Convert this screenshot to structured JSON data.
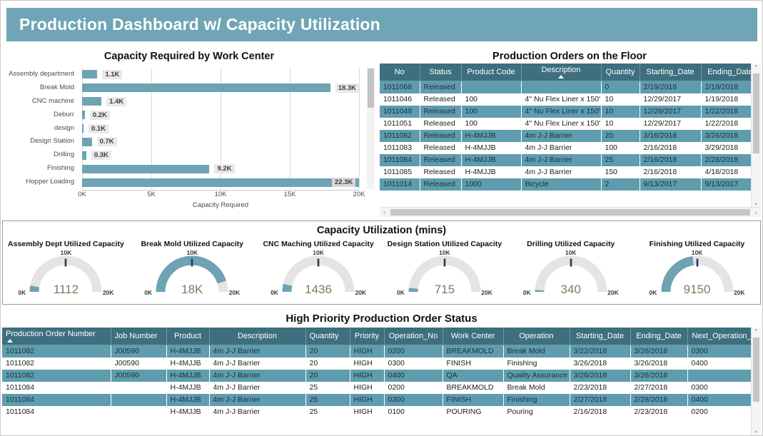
{
  "banner": {
    "title": "Production Dashboard w/ Capacity Utilization"
  },
  "chart_data": {
    "type": "bar",
    "orientation": "horizontal",
    "title": "Capacity Required by Work Center",
    "xlabel": "Capacity Required",
    "ylabel": "",
    "xlim": [
      0,
      20000
    ],
    "xticks": [
      "0K",
      "5K",
      "10K",
      "15K",
      "20K"
    ],
    "xtick_values": [
      0,
      5000,
      10000,
      15000,
      20000
    ],
    "grid": true,
    "categories": [
      "Assembly department",
      "Break Mold",
      "CNC machine",
      "Deburr",
      "design",
      "Design Station",
      "Drilling",
      "Finishing",
      "Hopper Loading"
    ],
    "values": [
      1100,
      18300,
      1400,
      200,
      100,
      700,
      300,
      9200,
      22300
    ],
    "labels": [
      "1.1K",
      "18.3K",
      "1.4K",
      "0.2K",
      "0.1K",
      "0.7K",
      "0.3K",
      "9.2K",
      "22.3K"
    ],
    "bar_color": "#6da3b3"
  },
  "orders_panel": {
    "title": "Production Orders on the Floor",
    "columns": [
      {
        "label": "No",
        "width": 56,
        "align": "center"
      },
      {
        "label": "Status",
        "width": 58,
        "align": "center"
      },
      {
        "label": "Product Code",
        "width": 84,
        "align": "center"
      },
      {
        "label": "Description",
        "width": 112,
        "align": "center",
        "sorted": "asc"
      },
      {
        "label": "Quantity",
        "width": 54,
        "align": "center"
      },
      {
        "label": "Starting_Date",
        "width": 86,
        "align": "center"
      },
      {
        "label": "Ending_Date",
        "width": 82,
        "align": "center"
      }
    ],
    "rows": [
      {
        "selected": true,
        "cells": [
          "1011068",
          "Released",
          "",
          "",
          "0",
          "2/19/2018",
          "2/19/2018"
        ]
      },
      {
        "selected": false,
        "cells": [
          "1011046",
          "Released",
          "100",
          "4\" Nu Flex Liner x 150'",
          "10",
          "12/29/2017",
          "1/19/2018"
        ]
      },
      {
        "selected": true,
        "cells": [
          "1011049",
          "Released",
          "100",
          "4\" Nu Flex Liner x 150'",
          "10",
          "12/29/2017",
          "1/22/2018"
        ]
      },
      {
        "selected": false,
        "cells": [
          "1011051",
          "Released",
          "100",
          "4\" Nu Flex Liner x 150'",
          "10",
          "12/29/2017",
          "1/22/2018"
        ]
      },
      {
        "selected": true,
        "cells": [
          "1011082",
          "Released",
          "H-4MJJB",
          "4m J-J Barrier",
          "20",
          "3/16/2018",
          "3/26/2018"
        ]
      },
      {
        "selected": false,
        "cells": [
          "1011083",
          "Released",
          "H-4MJJB",
          "4m J-J Barrier",
          "100",
          "2/16/2018",
          "3/29/2018"
        ]
      },
      {
        "selected": true,
        "cells": [
          "1011084",
          "Released",
          "H-4MJJB",
          "4m J-J Barrier",
          "25",
          "2/16/2018",
          "2/28/2018"
        ]
      },
      {
        "selected": false,
        "cells": [
          "1011085",
          "Released",
          "H-4MJJB",
          "4m J-J Barrier",
          "150",
          "2/16/2018",
          "4/18/2018"
        ]
      },
      {
        "selected": true,
        "cells": [
          "1011014",
          "Released",
          "1000",
          "Bicycle",
          "2",
          "9/13/2017",
          "9/13/2017"
        ]
      }
    ],
    "scroll": {
      "up_glyph": "⌃",
      "down_glyph": "⌄",
      "left_glyph": "‹",
      "right_glyph": "›"
    }
  },
  "gauges_panel": {
    "title": "Capacity Utilization (mins)",
    "min_label": "0K",
    "mid_label": "10K",
    "max_label": "20K",
    "min": 0,
    "max": 20000,
    "gauges": [
      {
        "title": "Assembly Dept Utilized Capacity",
        "value": 1112,
        "value_label": "1112"
      },
      {
        "title": "Break Mold Utilized Capacity",
        "value": 18000,
        "value_label": "18K"
      },
      {
        "title": "CNC Maching Utilized Capacity",
        "value": 1436,
        "value_label": "1436"
      },
      {
        "title": "Design Station Utilized Capacity",
        "value": 715,
        "value_label": "715"
      },
      {
        "title": "Drilling Utilized Capacity",
        "value": 340,
        "value_label": "340"
      },
      {
        "title": "Finishing Utilized Capacity",
        "value": 9150,
        "value_label": "9150"
      }
    ]
  },
  "priority_panel": {
    "title": "High Priority Production Order Status",
    "columns": [
      {
        "label": "Production Order Number",
        "width": 152,
        "align": "left",
        "sorted": "asc"
      },
      {
        "label": "Job Number",
        "width": 78,
        "align": "left"
      },
      {
        "label": "Product",
        "width": 60,
        "align": "center"
      },
      {
        "label": "Description",
        "width": 135,
        "align": "center"
      },
      {
        "label": "Quantity",
        "width": 62,
        "align": "left"
      },
      {
        "label": "Priority",
        "width": 48,
        "align": "center"
      },
      {
        "label": "Operation_No",
        "width": 82,
        "align": "center"
      },
      {
        "label": "Work Center",
        "width": 85,
        "align": "center"
      },
      {
        "label": "Operation",
        "width": 93,
        "align": "center"
      },
      {
        "label": "Starting_Date",
        "width": 85,
        "align": "center"
      },
      {
        "label": "Ending_Date",
        "width": 80,
        "align": "center"
      },
      {
        "label": "Next_Operation_No",
        "width": 110,
        "align": "center"
      }
    ],
    "rows": [
      {
        "selected": true,
        "cells": [
          "1011082",
          "J00590",
          "H-4MJJB",
          "4m J-J Barrier",
          "20",
          "HIGH",
          "0200",
          "BREAKMOLD",
          "Break Mold",
          "3/22/2018",
          "3/26/2018",
          "0300"
        ]
      },
      {
        "selected": false,
        "cells": [
          "1011082",
          "J00590",
          "H-4MJJB",
          "4m J-J Barrier",
          "20",
          "HIGH",
          "0300",
          "FINISH",
          "Finishing",
          "3/26/2018",
          "3/26/2018",
          "0400"
        ]
      },
      {
        "selected": true,
        "cells": [
          "1011082",
          "J00590",
          "H-4MJJB",
          "4m J-J Barrier",
          "20",
          "HIGH",
          "0400",
          "QA",
          "Quality Assurance",
          "3/26/2018",
          "3/26/2018",
          ""
        ]
      },
      {
        "selected": false,
        "cells": [
          "1011084",
          "",
          "H-4MJJB",
          "4m J-J Barrier",
          "25",
          "HIGH",
          "0200",
          "BREAKMOLD",
          "Break Mold",
          "2/23/2018",
          "2/27/2018",
          "0300"
        ]
      },
      {
        "selected": true,
        "cells": [
          "1011084",
          "",
          "H-4MJJB",
          "4m J-J Barrier",
          "25",
          "HIGH",
          "0300",
          "FINISH",
          "Finishing",
          "2/27/2018",
          "2/28/2018",
          "0400"
        ]
      },
      {
        "selected": false,
        "cells": [
          "1011084",
          "",
          "H-4MJJB",
          "4m J-J Barrier",
          "25",
          "HIGH",
          "0100",
          "POURING",
          "Pouring",
          "2/16/2018",
          "2/23/2018",
          "0200"
        ]
      }
    ],
    "scroll": {
      "up_glyph": "⌃",
      "down_glyph": "⌄"
    }
  },
  "colors": {
    "banner": "#6fa5b6",
    "header": "#3d6f7f",
    "selected_row": "#5f9cae",
    "bar": "#6da3b3",
    "gauge_fill": "#6da3b3",
    "gauge_track": "#e4e4e4"
  }
}
